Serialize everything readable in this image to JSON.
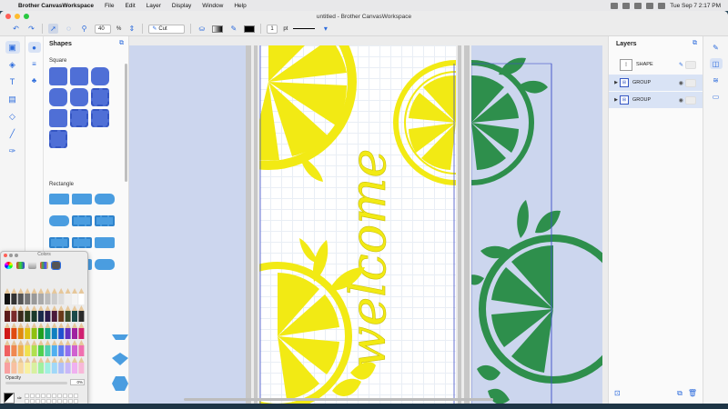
{
  "menubar": {
    "app_name": "Brother CanvasWorkspace",
    "items": [
      "File",
      "Edit",
      "Layer",
      "Display",
      "Window",
      "Help"
    ],
    "clock": "Tue Sep 7  2:17 PM"
  },
  "window": {
    "title": "untitled - Brother CanvasWorkspace"
  },
  "toolbar": {
    "zoom_value": "40",
    "zoom_unit": "%",
    "mode_label": "Cut",
    "line_width_value": "1",
    "line_width_unit": "pt"
  },
  "shapes_panel": {
    "title": "Shapes",
    "section_square": "Square",
    "section_rectangle": "Rectangle"
  },
  "layers_panel": {
    "title": "Layers",
    "rows": [
      {
        "label": "SHAPE",
        "selected": false
      },
      {
        "label": "GROUP",
        "selected": true
      },
      {
        "label": "GROUP",
        "selected": true
      }
    ]
  },
  "colors_panel": {
    "title": "Colors",
    "opacity_label": "Opacity",
    "opacity_value": "0%"
  },
  "artwork": {
    "text": "welcome",
    "yellow": "#f2ea14",
    "green": "#2e8f4c"
  },
  "colors": {
    "accent": "#2c6bdc",
    "mat": "#ccd6ee"
  }
}
